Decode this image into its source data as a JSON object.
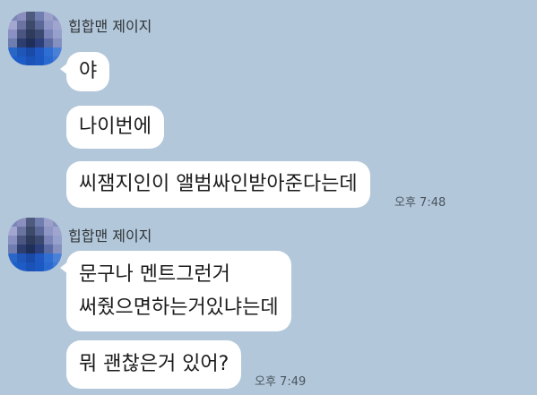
{
  "chat": {
    "groups": [
      {
        "sender": "힙합맨 제이지",
        "messages": [
          "야",
          "나이번에",
          "씨잼지인이 앨범싸인받아준다는데"
        ],
        "time": "오후 7:48"
      },
      {
        "sender": "힙합맨 제이지",
        "messages": [
          "문구나 멘트그런거",
          "써줬으면하는거있냐는데",
          "뭐 괜찮은거 있어?"
        ],
        "time": "오후 7:49"
      }
    ]
  },
  "colors": {
    "background": "#b2c7d9",
    "bubble": "#ffffff",
    "text": "#1b1b1b"
  }
}
